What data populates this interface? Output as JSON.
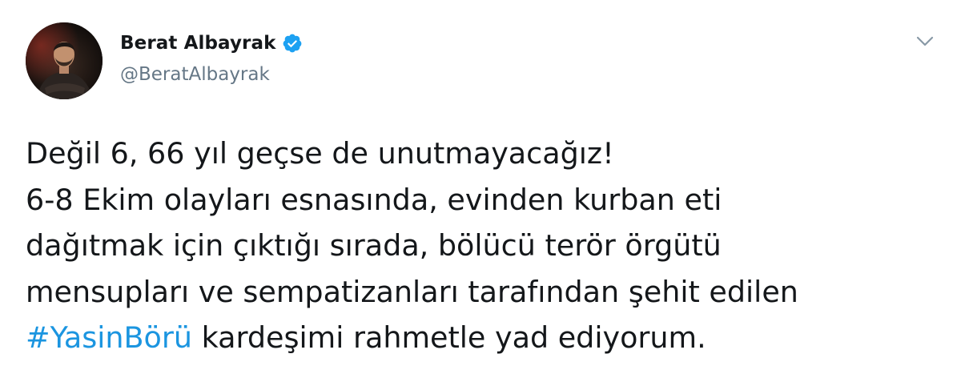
{
  "tweet": {
    "author": {
      "display_name": "Berat Albayrak",
      "handle": "@BeratAlbayrak",
      "verified": true,
      "avatar_icon": "profile-photo"
    },
    "menu_icon": "chevron-down-icon",
    "text": {
      "line1": "Değil 6, 66 yıl geçse de unutmayacağız!",
      "line2": "6-8 Ekim olayları esnasında, evinden kurban eti",
      "line3": "dağıtmak için çıktığı sırada, bölücü terör örgütü",
      "line4": "mensupları ve sempatizanları tarafından şehit edilen",
      "hashtag": "#YasinBörü",
      "line5_rest": " kardeşimi rahmetle yad ediyorum."
    },
    "colors": {
      "text": "#14171a",
      "handle": "#657786",
      "link": "#1b95e0",
      "verified_badge": "#1da1f2"
    }
  }
}
